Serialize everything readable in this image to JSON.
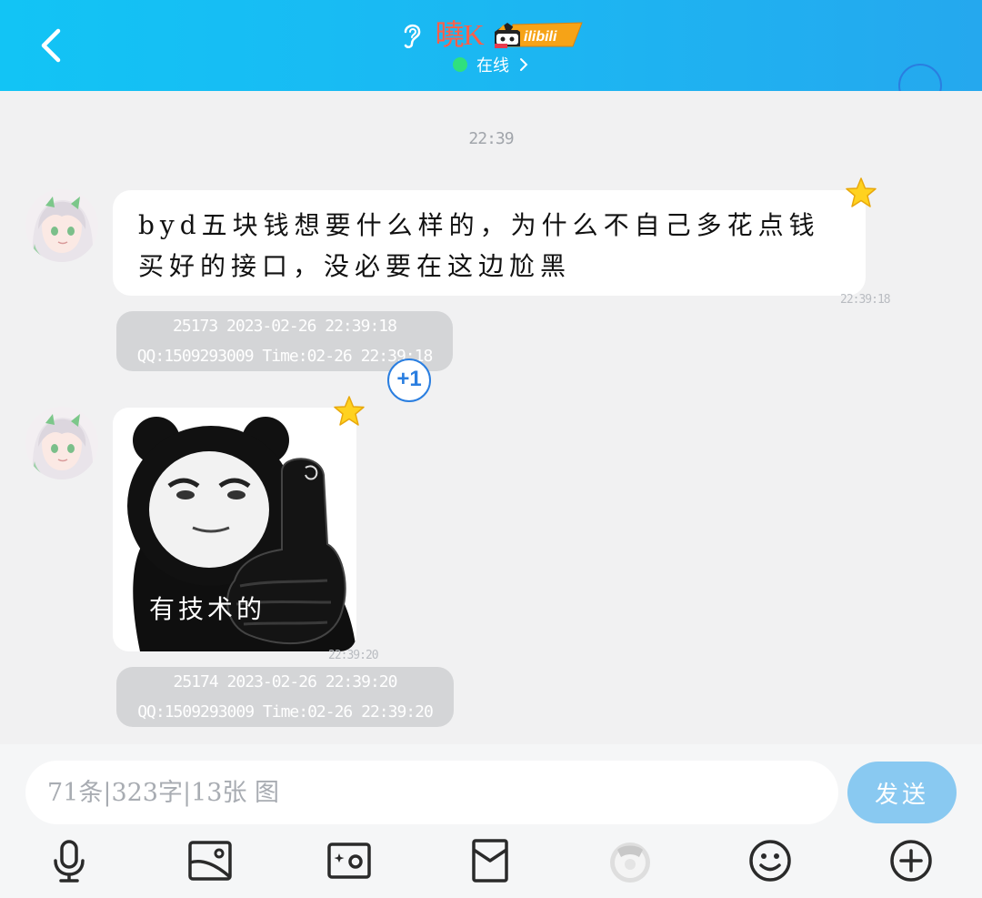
{
  "header": {
    "back_icon": "chevron-left-icon",
    "contact_name": "曉K",
    "badge_text": "ilibili",
    "status_text": "在线",
    "colors": {
      "bar_start": "#12c4f5",
      "bar_end": "#25a8ee",
      "name": "#ff5f4a",
      "online": "#2fe07e"
    }
  },
  "messages": {
    "time_divider": "22:39",
    "msg1": {
      "text": "byd五块钱想要什么样的，为什么不自己多花点钱买好的接口，没必要在这边尬黑",
      "time": "22:39:18",
      "card_line1": "25173  2023-02-26 22:39:18",
      "card_line2": "QQ:1509293009  Time:02-26 22:39:18"
    },
    "plus_one": "+1",
    "msg2": {
      "sticker_caption": "有技术的",
      "time": "22:39:20",
      "card_line1": "25174  2023-02-26 22:39:20",
      "card_line2": "QQ:1509293009  Time:02-26 22:39:20"
    }
  },
  "input": {
    "placeholder": "71条|323字|13张 图",
    "send_label": "发送",
    "send_color": "#89c9f1"
  },
  "toolbar": {
    "icons": [
      "microphone-icon",
      "photo-icon",
      "camera-icon",
      "red-packet-icon",
      "sticker-icon",
      "emoji-icon",
      "plus-icon"
    ]
  }
}
